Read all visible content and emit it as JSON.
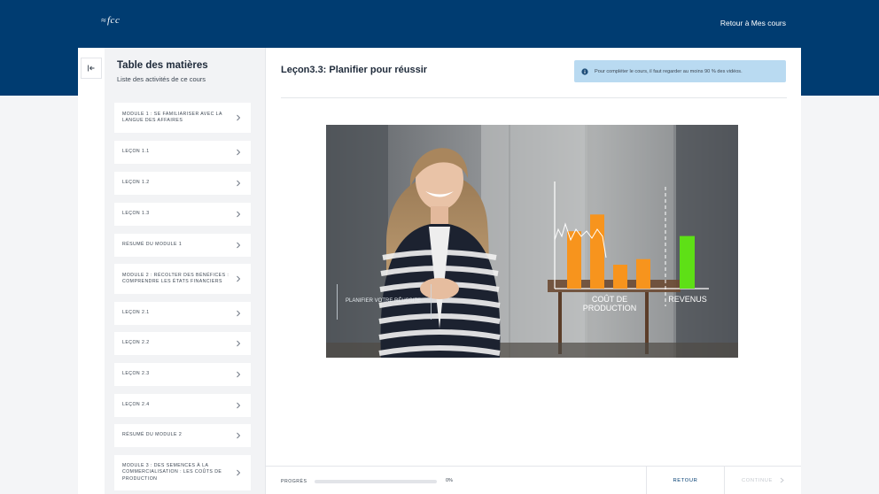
{
  "header": {
    "logo_text": "fcc",
    "back_link": "Retour à Mes cours"
  },
  "sidebar": {
    "title": "Table des matières",
    "subtitle": "Liste des activités de ce cours",
    "items": [
      {
        "label": "MODULE 1 : SE FAMILIARISER AVEC LA LANGUE DES AFFAIRES"
      },
      {
        "label": "LEÇON 1.1"
      },
      {
        "label": "LEÇON 1.2"
      },
      {
        "label": "LEÇON 1.3"
      },
      {
        "label": "RÉSUMÉ DU MODULE 1"
      },
      {
        "label": "MODULE 2 : RÉCOLTER DES BÉNÉFICES : COMPRENDRE LES ÉTATS FINANCIERS"
      },
      {
        "label": "LEÇON 2.1"
      },
      {
        "label": "LEÇON 2.2"
      },
      {
        "label": "LEÇON 2.3"
      },
      {
        "label": "LEÇON 2.4"
      },
      {
        "label": "RÉSUMÉ DU MODULE 2"
      },
      {
        "label": "MODULE 3 : DES SEMENCES À LA COMMERCIALISATION : LES COÛTS DE PRODUCTION"
      }
    ]
  },
  "main": {
    "lesson_title": "Leçon3.3: Planifier pour réussir",
    "notice": "Pour compléter le cours, il faut regarder au moins 90 % des vidéos."
  },
  "video": {
    "caption": "PLANIFIER VOTRE RÉUSSITE",
    "cost_label_line1": "COÛT DE",
    "cost_label_line2": "PRODUCTION",
    "revenue_label": "REVENUS",
    "cost_bar_color": "#f7941d",
    "revenue_bar_color": "#5ee016",
    "cost_bars": [
      0.72,
      0.93,
      0.3,
      0.37
    ],
    "revenue_bars": [
      0.66
    ]
  },
  "footer": {
    "progress_label": "PROGRÈS",
    "progress_percent": "0%",
    "progress_value": 0,
    "back_label": "RETOUR",
    "continue_label": "CONTINUE"
  },
  "icons": {
    "collapse": "collapse-left-icon",
    "chevron": "chevron-right-icon",
    "info": "info-icon",
    "next": "chevron-right-icon"
  },
  "colors": {
    "brand": "#003c71",
    "notice_bg": "#b9daf1"
  }
}
